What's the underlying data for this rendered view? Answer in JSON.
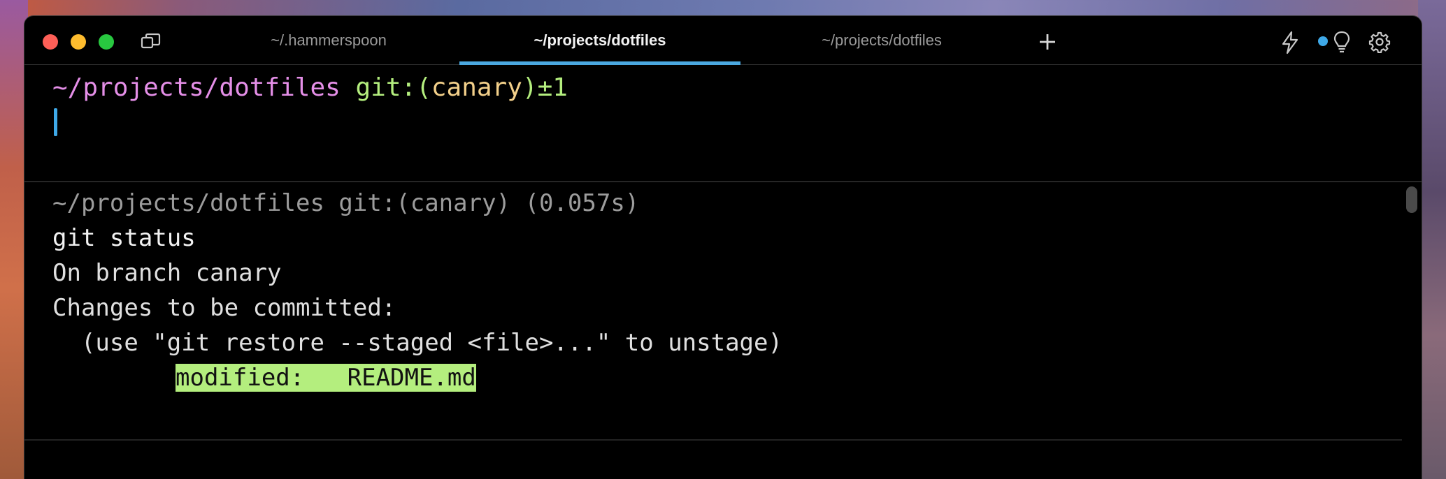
{
  "tabs": [
    {
      "label": "~/.hammerspoon",
      "active": false
    },
    {
      "label": "~/projects/dotfiles",
      "active": true
    },
    {
      "label": "~/projects/dotfiles",
      "active": false
    }
  ],
  "prompt": {
    "path": "~/projects/dotfiles",
    "git_prefix": "git:(",
    "branch": "canary",
    "git_suffix": ")±1"
  },
  "block": {
    "header": "~/projects/dotfiles git:(canary) (0.057s)",
    "command": "git status",
    "output": [
      "On branch canary",
      "Changes to be committed:",
      "  (use \"git restore --staged <file>...\" to unstage)"
    ],
    "highlight_line": "modified:   README.md"
  },
  "colors": {
    "path": "#e58fe8",
    "git": "#b4ee7e",
    "branch": "#f3d08a",
    "accent": "#4aa8e0",
    "highlight_bg": "#b4ee7e"
  },
  "icons": {
    "sidebar": "sidebar-toggle-icon",
    "new_tab": "plus-icon",
    "workflows": "lightning-icon",
    "notification": "dot-icon",
    "ai": "lightbulb-icon",
    "settings": "gear-icon"
  }
}
